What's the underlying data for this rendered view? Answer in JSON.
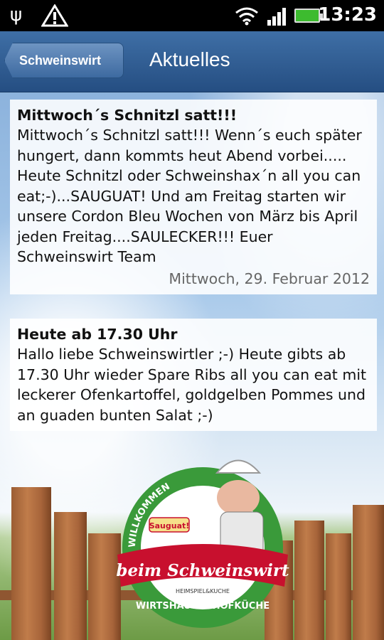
{
  "status_bar": {
    "time": "13:23",
    "icons": [
      "usb-icon",
      "warning-icon",
      "wifi-icon",
      "signal-icon",
      "battery-charging-icon"
    ]
  },
  "header": {
    "back_label": "Schweinswirt",
    "title": "Aktuelles"
  },
  "posts": [
    {
      "title": "Mittwoch´s Schnitzl satt!!!",
      "body": "Mittwoch´s Schnitzl satt!!! Wenn´s euch später hungert, dann kommts heut Abend vorbei..... Heute Schnitzl oder Schweinshax´n all you can eat;-)...SAUGUAT! Und am Freitag starten wir unsere Cordon Bleu Wochen von März bis April jeden Freitag....SAULECKER!!! Euer Schweinswirt Team",
      "date": "Mittwoch, 29. Februar 2012"
    },
    {
      "title": "Heute ab 17.30 Uhr",
      "body": "Hallo liebe Schweinswirtler ;-) Heute gibts ab 17.30 Uhr wieder Spare Ribs all you can eat mit leckerer Ofenkartoffel, goldgelben Pommes und an guaden bunten Salat ;-)"
    }
  ],
  "logo": {
    "arc_text": "WILLKOMMEN",
    "badge": "Sauguat!",
    "name": "beim Schweinswirt",
    "tagline": "WIRTSHAUS & HOFKÜCHE",
    "small_text": "HEIMSPIEL&KUCHE"
  },
  "colors": {
    "title_bar": "#2d5a8f",
    "logo_green": "#3a9a3a",
    "logo_red": "#c8102e"
  }
}
